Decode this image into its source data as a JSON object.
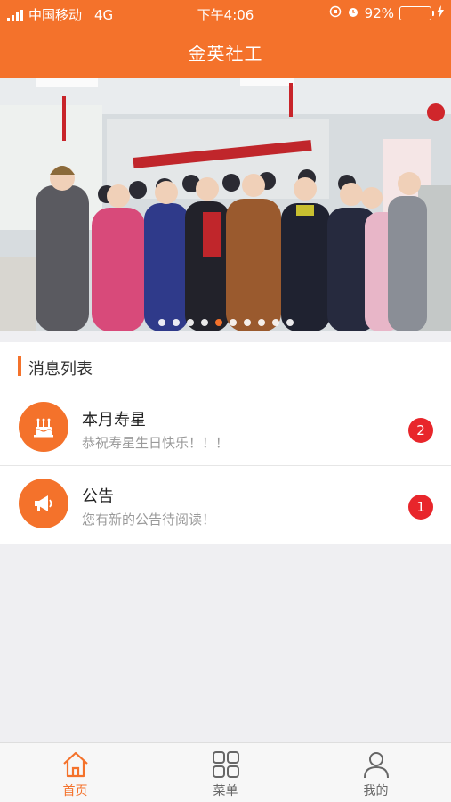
{
  "status_bar": {
    "carrier": "中国移动",
    "network": "4G",
    "time": "下午4:06",
    "battery": "92%",
    "battery_level": 0.92
  },
  "header": {
    "title": "金英社工"
  },
  "banner": {
    "slide_count": 10,
    "active_index": 4
  },
  "messages": {
    "section_title": "消息列表",
    "items": [
      {
        "title": "本月寿星",
        "subtitle": "恭祝寿星生日快乐！！！",
        "badge": "2",
        "icon": "cake-icon"
      },
      {
        "title": "公告",
        "subtitle": "您有新的公告待阅读！",
        "badge": "1",
        "icon": "megaphone-icon"
      }
    ]
  },
  "tabbar": {
    "items": [
      {
        "label": "首页",
        "icon": "home-icon",
        "active": true
      },
      {
        "label": "菜单",
        "icon": "grid-menu-icon",
        "active": false
      },
      {
        "label": "我的",
        "icon": "user-icon",
        "active": false
      }
    ]
  },
  "colors": {
    "accent": "#f4722b",
    "badge": "#e8262b",
    "background": "#efeff2"
  }
}
